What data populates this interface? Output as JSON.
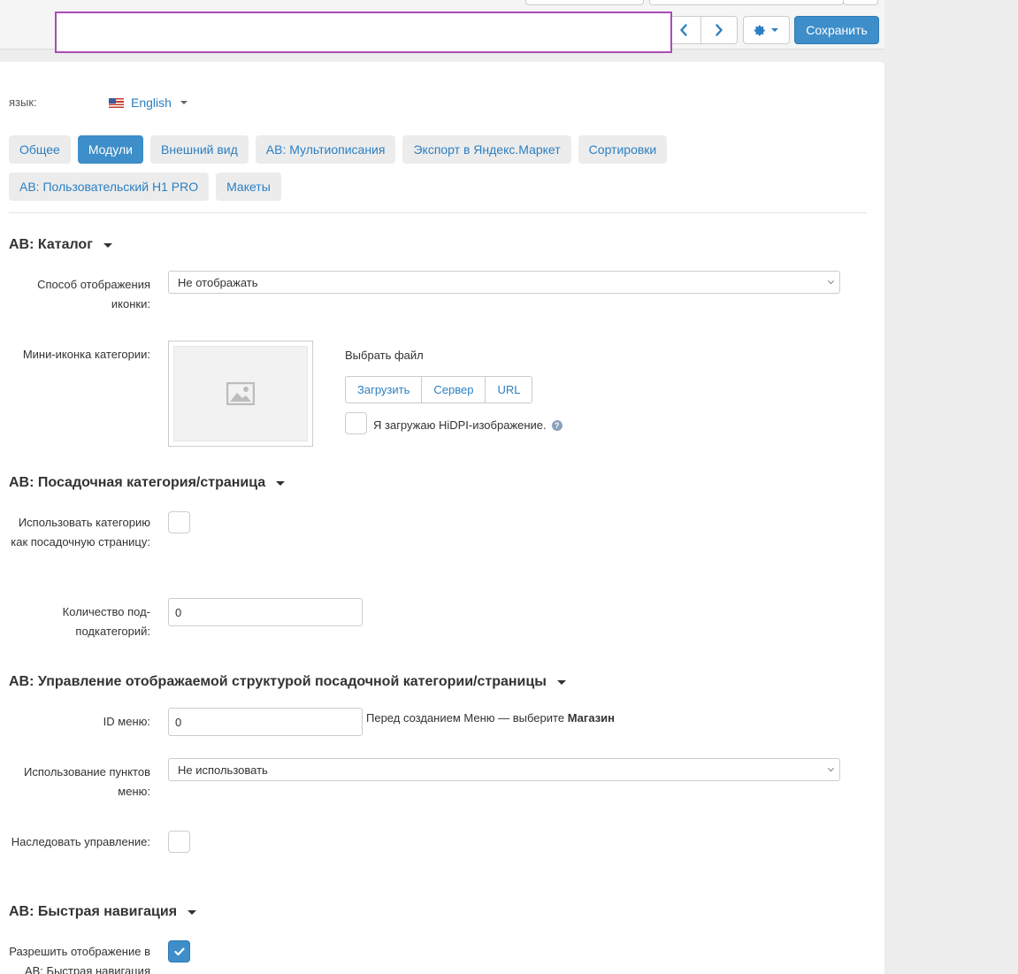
{
  "toolbar": {
    "prev_icon": "chevron-left-icon",
    "next_icon": "chevron-right-icon",
    "settings_icon": "gear-icon",
    "save_label": "Сохранить"
  },
  "language": {
    "label": "язык:",
    "selected": "English",
    "flag_icon": "us-flag-icon"
  },
  "tabs": [
    {
      "label": "Общее",
      "active": false
    },
    {
      "label": "Модули",
      "active": true
    },
    {
      "label": "Внешний вид",
      "active": false
    },
    {
      "label": "AB: Мультиописания",
      "active": false
    },
    {
      "label": "Экспорт в Яндекс.Маркет",
      "active": false
    },
    {
      "label": "Сортировки",
      "active": false
    },
    {
      "label": "AB: Пользовательский H1 PRO",
      "active": false
    },
    {
      "label": "Макеты",
      "active": false
    }
  ],
  "catalog": {
    "title": "AB: Каталог",
    "icon_display_label": "Способ отображения иконки:",
    "icon_display_value": "Не отображать",
    "mini_icon_label": "Мини-иконка категории:",
    "choose_file": "Выбрать файл",
    "upload_buttons": [
      "Загрузить",
      "Сервер",
      "URL"
    ],
    "hidpi_label": "Я загружаю HiDPI-изображение."
  },
  "landing": {
    "title": "AB: Посадочная категория/страница",
    "use_as_landing_label": "Использовать категорию как посадочную страницу:",
    "use_as_landing_checked": false,
    "subsub_count_label": "Количество под-подкатегорий:",
    "subsub_count_value": "0"
  },
  "structure": {
    "title": "AB: Управление отображаемой структурой посадочной категории/страницы",
    "menu_id_label": "ID меню:",
    "menu_id_value": "0",
    "menu_hint_prefix": "Перед созданием Меню — выберите",
    "menu_hint_bold": "Магазин",
    "menu_items_label": "Использование пунктов меню:",
    "menu_items_value": "Не использовать",
    "inherit_label": "Наследовать управление:",
    "inherit_checked": false
  },
  "quicknav": {
    "title": "AB: Быстрая навигация",
    "allow_label": "Разрешить отображение в AB: Быстрая навигация",
    "allow_checked": true
  },
  "colors": {
    "primary": "#3d8ec9",
    "link": "#2b7fc2",
    "highlight": "#a94db5"
  }
}
